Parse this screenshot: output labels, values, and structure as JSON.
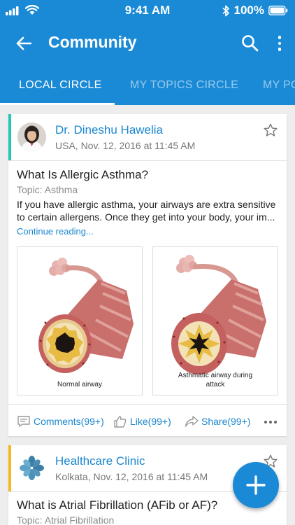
{
  "status_bar": {
    "time": "9:41 AM",
    "battery_percent": "100%"
  },
  "app_bar": {
    "title": "Community"
  },
  "tabs": [
    {
      "label": "LOCAL CIRCLE",
      "active": true
    },
    {
      "label": "MY TOPICS CIRCLE",
      "active": false
    },
    {
      "label": "MY PO",
      "active": false
    }
  ],
  "posts": [
    {
      "author": "Dr. Dineshu Hawelia",
      "meta": "USA, Nov. 12, 2016 at 11:45 AM",
      "accent_color": "#26c6b5",
      "title": "What Is Allergic Asthma?",
      "topic": "Topic: Asthma",
      "excerpt": "If you have allergic asthma, your airways are extra sensitive to certain allergens. Once they get into your body, your im...",
      "continue_label": "Continue reading...",
      "images": [
        {
          "caption": "Normal airway"
        },
        {
          "caption": "Asthmatic airway during attack"
        }
      ],
      "actions": {
        "comments": "Comments(99+)",
        "like": "Like(99+)",
        "share": "Share(99+)"
      }
    },
    {
      "author": "Healthcare Clinic",
      "meta": "Kolkata, Nov. 12, 2016 at 11:45 AM",
      "accent_color": "#f5b921",
      "title": "What is Atrial Fibrillation (AFib or AF)?",
      "topic": "Topic: Atrial Fibrillation"
    }
  ],
  "colors": {
    "primary": "#1a8ad6",
    "link": "#1a87cf"
  }
}
